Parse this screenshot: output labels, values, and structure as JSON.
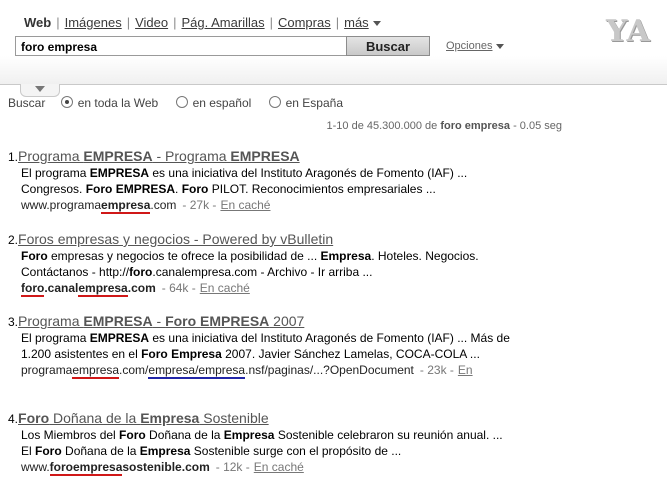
{
  "verticals": [
    {
      "label": "Web",
      "active": true
    },
    {
      "label": "Imágenes"
    },
    {
      "label": "Video"
    },
    {
      "label": "Pág. Amarillas"
    },
    {
      "label": "Compras"
    }
  ],
  "more_label": "más",
  "search": {
    "query": "foro empresa",
    "button": "Buscar",
    "options": "Opciones"
  },
  "logo": "YA",
  "scope": {
    "label": "Buscar",
    "options": [
      "en toda la Web",
      "en español",
      "en España"
    ]
  },
  "summary": {
    "prefix": "1-10 de 45.300.000 de",
    "query": "foro empresa",
    "suffix": "- 0.05 seg"
  },
  "results": [
    {
      "num": "1.",
      "title": [
        "Programa ",
        "EMPRESA",
        " - Programa ",
        "EMPRESA"
      ],
      "snip1": [
        "El programa ",
        "EMPRESA",
        " es una iniciativa del Instituto Aragonés de Fomento (IAF) ..."
      ],
      "snip2": [
        "Congresos. ",
        "Foro EMPRESA",
        ". ",
        "Foro",
        " PILOT. Reconocimientos empresariales ..."
      ],
      "url": [
        "www.programa",
        "empresa",
        ".com"
      ],
      "size": "- 27k -",
      "cache": "En caché"
    },
    {
      "num": "2.",
      "title": [
        "Foros empresas y negocios - Powered by vBulletin"
      ],
      "snip1": [
        "Foro",
        " empresas y negocios te ofrece la posibilidad de ... ",
        "Empresa",
        ". Hoteles. Negocios."
      ],
      "snip2": [
        "Contáctanos - http://",
        "foro",
        ".canalempresa.com - Archivo - Ir arriba ..."
      ],
      "url": [
        "foro",
        ".canal",
        "empresa",
        ".com"
      ],
      "size": "- 64k -",
      "cache": "En caché"
    },
    {
      "num": "3.",
      "title": [
        "Programa ",
        "EMPRESA",
        " - ",
        "Foro EMPRESA",
        " 2007"
      ],
      "snip1": [
        "El programa ",
        "EMPRESA",
        " es una iniciativa del Instituto Aragonés de Fomento (IAF) ... Más de"
      ],
      "snip2": [
        "1.200 asistentes en el ",
        "Foro Empresa",
        " 2007. Javier Sánchez Lamelas, COCA-COLA ..."
      ],
      "url": [
        "programa",
        "empresa",
        ".com/",
        "empresa/empresa",
        ".nsf/paginas/...?OpenDocument"
      ],
      "size": "- 23k -",
      "cache": "En"
    },
    {
      "num": "4.",
      "title": [
        "Foro",
        " Doñana de la ",
        "Empresa",
        " Sostenible"
      ],
      "snip1": [
        "Los Miembros del ",
        "Foro",
        " Doñana de la ",
        "Empresa",
        " Sostenible celebraron su reunión anual. ..."
      ],
      "snip2": [
        "El ",
        "Foro",
        " Doñana de la ",
        "Empresa",
        " Sostenible surge con el propósito de ..."
      ],
      "url": [
        "www.",
        "foroempresa",
        "sostenible",
        ".com"
      ],
      "size": "- 12k -",
      "cache": "En caché"
    }
  ]
}
